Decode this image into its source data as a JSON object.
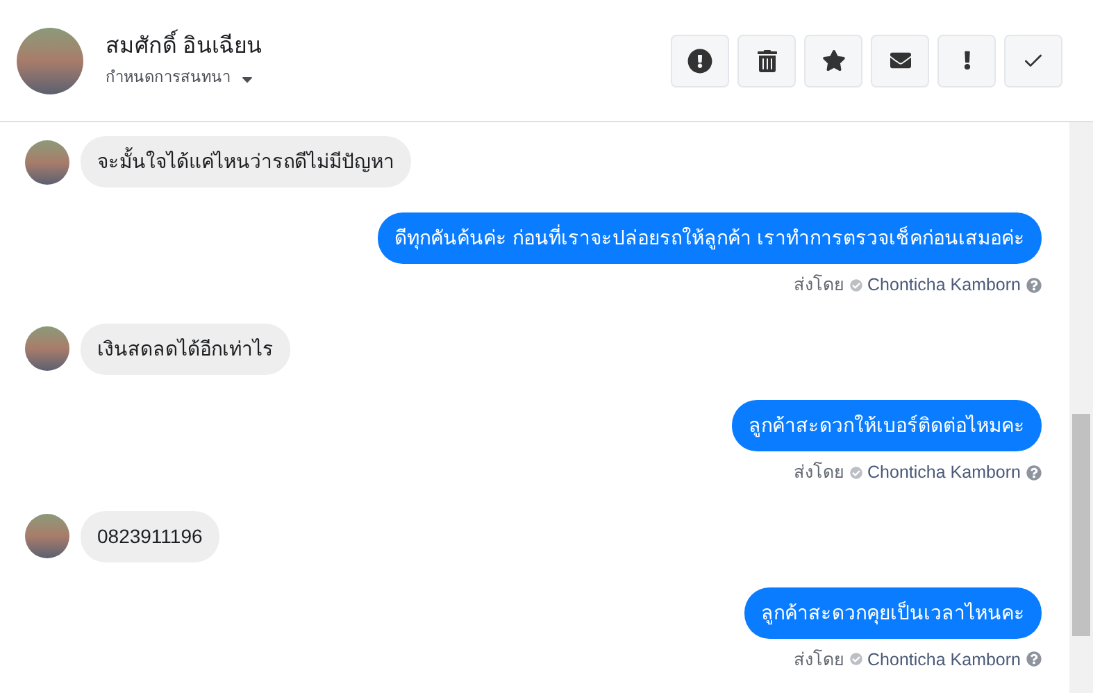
{
  "contact": {
    "name": "สมศักดิ์ อินเฉียน",
    "conversation_menu": "กำหนดการสนทนา"
  },
  "messages": [
    {
      "kind": "incoming",
      "text": "จะมั้นใจได้แค่ไหนว่ารถดีไม่มีปัญหา"
    },
    {
      "kind": "outgoing",
      "text": "ดีทุกคันค้นค่ะ ก่อนที่เราจะปล่อยรถให้ลูกค้า เราทำการตรวจเช็คก่อนเสมอค่ะ",
      "sender_label": "ส่งโดย",
      "sender_name": "Chonticha Kamborn"
    },
    {
      "kind": "incoming",
      "text": "เงินสดลดได้อีกเท่าไร"
    },
    {
      "kind": "outgoing",
      "text": "ลูกค้าสะดวกให้เบอร์ติดต่อไหมคะ",
      "sender_label": "ส่งโดย",
      "sender_name": "Chonticha Kamborn"
    },
    {
      "kind": "incoming",
      "text": "0823911196"
    },
    {
      "kind": "outgoing",
      "text": "ลูกค้าสะดวกคุยเป็นเวลาไหนคะ",
      "sender_label": "ส่งโดย",
      "sender_name": "Chonticha Kamborn"
    }
  ]
}
